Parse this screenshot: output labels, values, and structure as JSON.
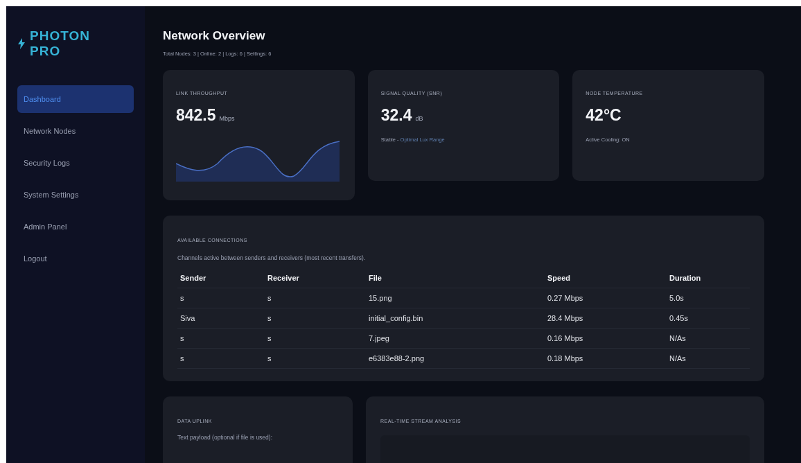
{
  "brand": {
    "name": "PHOTON PRO"
  },
  "sidebar": {
    "items": [
      {
        "label": "Dashboard",
        "selected": true
      },
      {
        "label": "Network Nodes",
        "selected": false
      },
      {
        "label": "Security Logs",
        "selected": false
      },
      {
        "label": "System Settings",
        "selected": false
      },
      {
        "label": "Admin Panel",
        "selected": false
      },
      {
        "label": "Logout",
        "selected": false
      }
    ]
  },
  "header": {
    "title": "Network Overview",
    "summary": "Total Nodes: 3 | Online: 2 | Logs: 6 | Settings: 6"
  },
  "stats": [
    {
      "kind": "sparkline",
      "label": "LINK THROUGHPUT",
      "value": "842.5",
      "unit": "Mbps"
    },
    {
      "kind": "note",
      "label": "SIGNAL QUALITY (SNR)",
      "value": "32.4",
      "unit": "dB",
      "note": "Stable - ",
      "note_highlight": "Optimal Lux Range"
    },
    {
      "kind": "note",
      "label": "NODE TEMPERATURE",
      "value": "42°C",
      "note": "Active Cooling: ON"
    }
  ],
  "connections": {
    "title": "AVAILABLE CONNECTIONS",
    "description": "Channels active between senders and receivers (most recent transfers).",
    "columns": [
      "Sender",
      "Receiver",
      "File",
      "Speed",
      "Duration"
    ],
    "rows": [
      [
        "s",
        "s",
        "15.png",
        "0.27 Mbps",
        "5.0s"
      ],
      [
        "Siva",
        "s",
        "initial_config.bin",
        "28.4 Mbps",
        "0.45s"
      ],
      [
        "s",
        "s",
        "7.jpeg",
        "0.16 Mbps",
        "N/As"
      ],
      [
        "s",
        "s",
        "e6383e88-2.png",
        "0.18 Mbps",
        "N/As"
      ]
    ]
  },
  "uplink": {
    "title": "DATA UPLINK",
    "field_label": "Text payload (optional if file is used):"
  },
  "stream": {
    "title": "REAL-TIME STREAM ANALYSIS"
  }
}
